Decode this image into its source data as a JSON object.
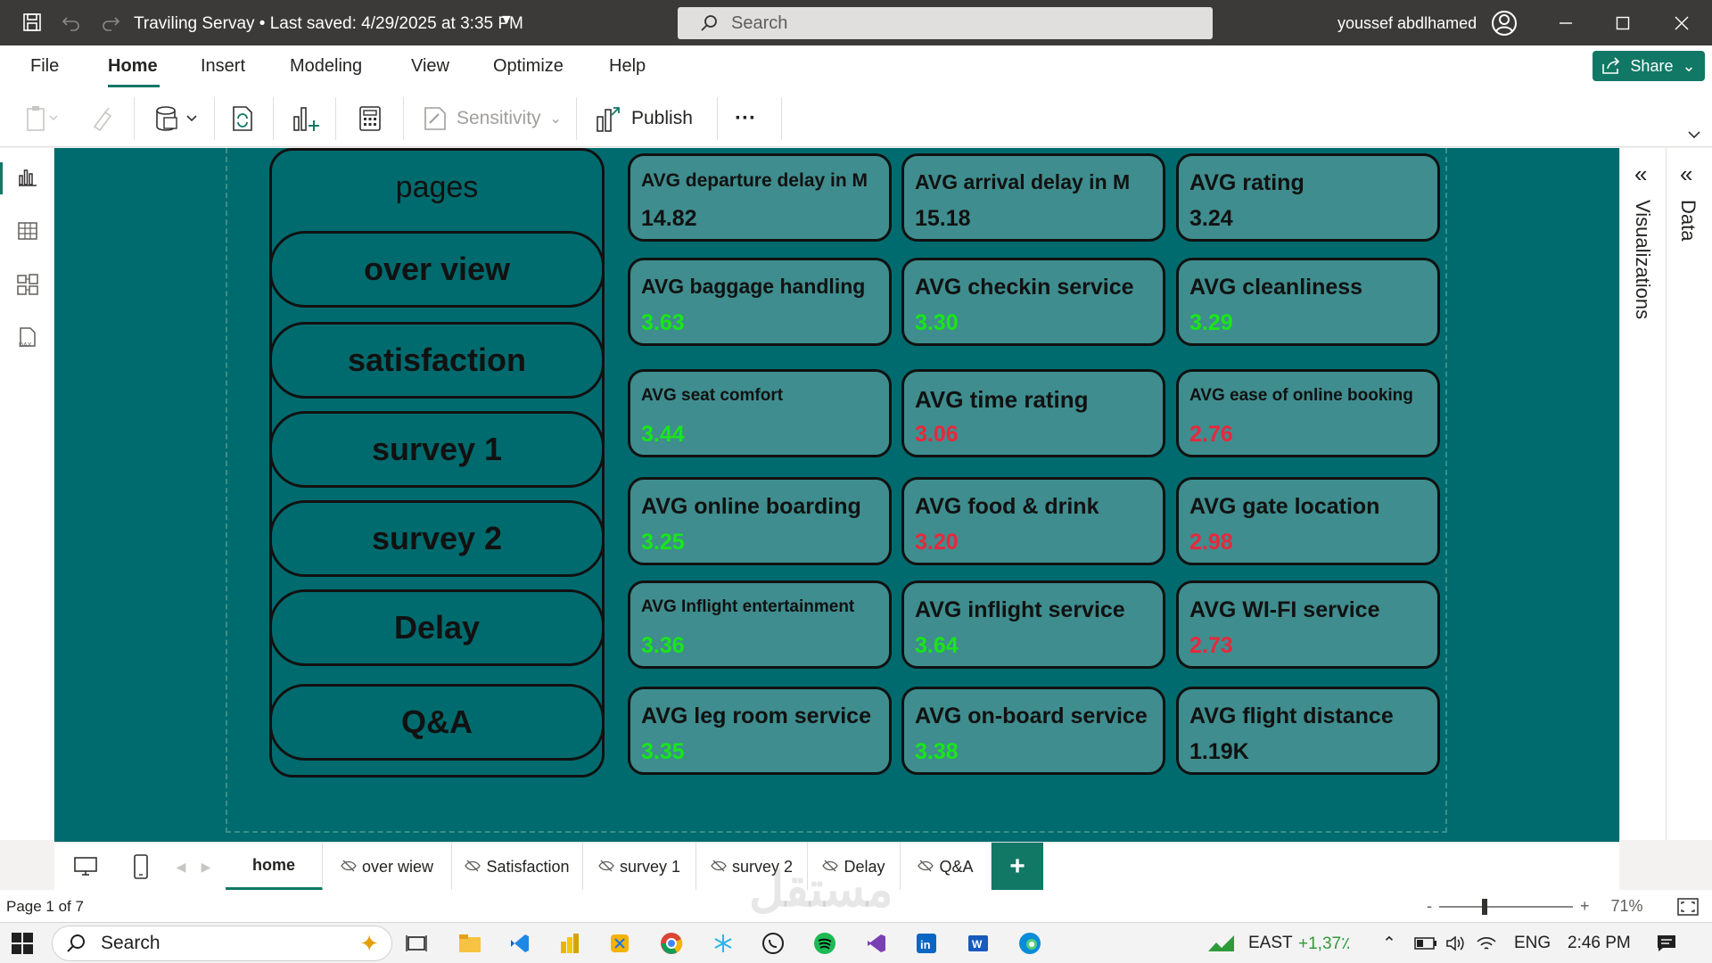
{
  "titlebar": {
    "title": "Traviling Servay  •  Last saved: 4/29/2025 at 3:35 PM",
    "search_placeholder": "Search",
    "user": "youssef abdlhamed"
  },
  "menu": {
    "items": [
      {
        "label": "File"
      },
      {
        "label": "Home"
      },
      {
        "label": "Insert"
      },
      {
        "label": "Modeling"
      },
      {
        "label": "View"
      },
      {
        "label": "Optimize"
      },
      {
        "label": "Help"
      }
    ],
    "active": "Home",
    "share_label": "Share"
  },
  "toolbar": {
    "sensitivity_label": "Sensitivity",
    "publish_label": "Publish",
    "more_label": "···"
  },
  "report": {
    "pages_title": "pages",
    "nav_buttons": [
      {
        "label": "over view"
      },
      {
        "label": "satisfaction"
      },
      {
        "label": "survey 1"
      },
      {
        "label": "survey 2"
      },
      {
        "label": "Delay"
      },
      {
        "label": "Q&A"
      }
    ],
    "cards": [
      {
        "label": "AVG departure delay in M",
        "value": "14.82",
        "color": "#111111"
      },
      {
        "label": "AVG arrival delay in M",
        "value": "15.18",
        "color": "#111111"
      },
      {
        "label": "AVG rating",
        "value": "3.24",
        "color": "#111111"
      },
      {
        "label": "AVG baggage handling",
        "value": "3.63",
        "color": "#19e619"
      },
      {
        "label": "AVG checkin service",
        "value": "3.30",
        "color": "#19e619"
      },
      {
        "label": "AVG cleanliness",
        "value": "3.29",
        "color": "#19e619"
      },
      {
        "label": "AVG seat comfort",
        "value": "3.44",
        "color": "#19e619"
      },
      {
        "label": "AVG time rating",
        "value": "3.06",
        "color": "#e8283c"
      },
      {
        "label": "AVG ease of online booking",
        "value": "2.76",
        "color": "#e8283c"
      },
      {
        "label": "AVG online boarding",
        "value": "3.25",
        "color": "#19e619"
      },
      {
        "label": "AVG food & drink",
        "value": "3.20",
        "color": "#e8283c"
      },
      {
        "label": "AVG gate location",
        "value": "2.98",
        "color": "#e8283c"
      },
      {
        "label": "AVG Inflight entertainment",
        "value": "3.36",
        "color": "#19e619"
      },
      {
        "label": "AVG inflight service",
        "value": "3.64",
        "color": "#19e619"
      },
      {
        "label": "AVG WI-FI service",
        "value": "2.73",
        "color": "#e8283c"
      },
      {
        "label": "AVG leg room service",
        "value": "3.35",
        "color": "#19e619"
      },
      {
        "label": "AVG on-board service",
        "value": "3.38",
        "color": "#19e619"
      },
      {
        "label": "AVG flight distance",
        "value": "1.19K",
        "color": "#111111"
      }
    ]
  },
  "panes": {
    "visualizations_label": "Visualizations",
    "data_label": "Data"
  },
  "page_tabs": [
    {
      "label": "home",
      "hidden": false
    },
    {
      "label": "over wiew",
      "hidden": true
    },
    {
      "label": "Satisfaction",
      "hidden": true
    },
    {
      "label": "survey 1",
      "hidden": true
    },
    {
      "label": "survey 2",
      "hidden": true
    },
    {
      "label": "Delay",
      "hidden": true
    },
    {
      "label": "Q&A",
      "hidden": true
    }
  ],
  "status": {
    "page_indicator": "Page 1 of 7",
    "zoom": "71%",
    "zoom_minus": "-",
    "zoom_plus": "+"
  },
  "watermark": "مستقل",
  "taskbar": {
    "search_placeholder": "Search",
    "stock_label": "EAST",
    "stock_change": "+1,37٪",
    "language": "ENG",
    "time": "2:46 PM"
  },
  "colors": {
    "accent": "#117865",
    "canvas": "#006b6e",
    "card": "#3f8d8e",
    "good": "#19e619",
    "bad": "#e8283c"
  }
}
